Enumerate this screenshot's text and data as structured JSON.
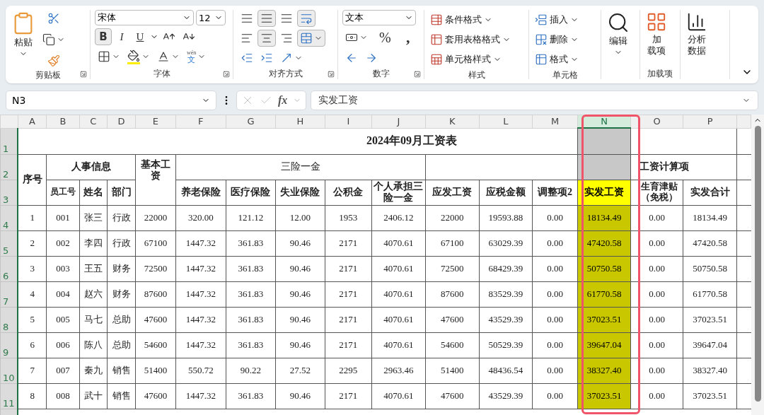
{
  "ribbon": {
    "groups": [
      {
        "kind": "clipboard",
        "label": "剪贴板",
        "paste": "粘贴"
      },
      {
        "kind": "font",
        "label": "字体",
        "font": "宋体",
        "size": "12",
        "bold": {
          "text": "B",
          "selected": true
        },
        "italic": {
          "text": "I",
          "selected": false
        },
        "underline": {
          "text": "U",
          "selected": false
        },
        "phonetic_top": "wén",
        "phonetic_bottom": "文"
      },
      {
        "kind": "alignment",
        "label": "对齐方式",
        "vertical": [
          {
            "selected": false
          },
          {
            "selected": true
          },
          {
            "selected": false
          }
        ],
        "horizontal": [
          {
            "selected": false
          },
          {
            "selected": true
          },
          {
            "selected": false
          }
        ],
        "wrap_text": {
          "selected": true
        },
        "merge": {
          "selected": true
        }
      },
      {
        "kind": "number",
        "label": "数字",
        "format": "文本",
        "percent": "%",
        "comma": ","
      },
      {
        "kind": "styles",
        "label": "样式",
        "items": [
          "条件格式",
          "套用表格格式",
          "单元格样式"
        ]
      },
      {
        "kind": "cells",
        "label": "单元格",
        "items": [
          "插入",
          "删除",
          "格式"
        ]
      },
      {
        "kind": "editing",
        "button": "编辑"
      },
      {
        "kind": "addins",
        "label": "加载项",
        "button": "加载项"
      },
      {
        "kind": "analysis",
        "button": "分析数据"
      }
    ]
  },
  "formula_bar": {
    "name_box": "N3",
    "fx": "fx",
    "value": "实发工资"
  },
  "sheet": {
    "columns": [
      {
        "letter": "A",
        "selected": false
      },
      {
        "letter": "B",
        "selected": false
      },
      {
        "letter": "C",
        "selected": false
      },
      {
        "letter": "D",
        "selected": false
      },
      {
        "letter": "E",
        "selected": false
      },
      {
        "letter": "F",
        "selected": false
      },
      {
        "letter": "G",
        "selected": false
      },
      {
        "letter": "H",
        "selected": false
      },
      {
        "letter": "I",
        "selected": false
      },
      {
        "letter": "J",
        "selected": false
      },
      {
        "letter": "K",
        "selected": false
      },
      {
        "letter": "L",
        "selected": false
      },
      {
        "letter": "M",
        "selected": false
      },
      {
        "letter": "N",
        "selected": true
      },
      {
        "letter": "O",
        "selected": false
      },
      {
        "letter": "P",
        "selected": false
      }
    ],
    "row_numbers": [
      "1",
      "2",
      "3",
      "4",
      "5",
      "6",
      "7",
      "8",
      "9",
      "10",
      "11"
    ],
    "title": "2024年09月工资表",
    "serial_header": "序号",
    "personnel_header": "人事信息",
    "base_salary_header": "基本工资",
    "insurance_header": "三险一金",
    "calc_header": "工资计算项",
    "headers": [
      "员工号",
      "姓名",
      "部门",
      "养老保险",
      "医疗保险",
      "失业保险",
      "公积金",
      "个人承担三险一金",
      "应发工资",
      "应税金额",
      "调整项2",
      "实发工资",
      "生育津贴（免税）",
      "实发合计"
    ],
    "rows": [
      [
        "1",
        "001",
        "张三",
        "行政",
        "22000",
        "320.00",
        "121.12",
        "12.00",
        "1953",
        "2406.12",
        "22000",
        "19593.88",
        "0.00",
        "18134.49",
        "0.00",
        "18134.49"
      ],
      [
        "2",
        "002",
        "李四",
        "行政",
        "67100",
        "1447.32",
        "361.83",
        "90.46",
        "2171",
        "4070.61",
        "67100",
        "63029.39",
        "0.00",
        "47420.58",
        "0.00",
        "47420.58"
      ],
      [
        "3",
        "003",
        "王五",
        "财务",
        "72500",
        "1447.32",
        "361.83",
        "90.46",
        "2171",
        "4070.61",
        "72500",
        "68429.39",
        "0.00",
        "50750.58",
        "0.00",
        "50750.58"
      ],
      [
        "4",
        "004",
        "赵六",
        "财务",
        "87600",
        "1447.32",
        "361.83",
        "90.46",
        "2171",
        "4070.61",
        "87600",
        "83529.39",
        "0.00",
        "61770.58",
        "0.00",
        "61770.58"
      ],
      [
        "5",
        "005",
        "马七",
        "总助",
        "47600",
        "1447.32",
        "361.83",
        "90.46",
        "2171",
        "4070.61",
        "47600",
        "43529.39",
        "0.00",
        "37023.51",
        "0.00",
        "37023.51"
      ],
      [
        "6",
        "006",
        "陈八",
        "总助",
        "54600",
        "1447.32",
        "361.83",
        "90.46",
        "2171",
        "4070.61",
        "54600",
        "50529.39",
        "0.00",
        "39647.04",
        "0.00",
        "39647.04"
      ],
      [
        "7",
        "007",
        "秦九",
        "销售",
        "51400",
        "550.72",
        "90.22",
        "27.52",
        "2295",
        "2963.46",
        "51400",
        "48436.54",
        "0.00",
        "38327.40",
        "0.00",
        "38327.40"
      ],
      [
        "8",
        "008",
        "武十",
        "销售",
        "47600",
        "1447.32",
        "361.83",
        "90.46",
        "2171",
        "4070.61",
        "47600",
        "43529.39",
        "0.00",
        "37023.51",
        "0.00",
        "37023.51"
      ]
    ]
  }
}
